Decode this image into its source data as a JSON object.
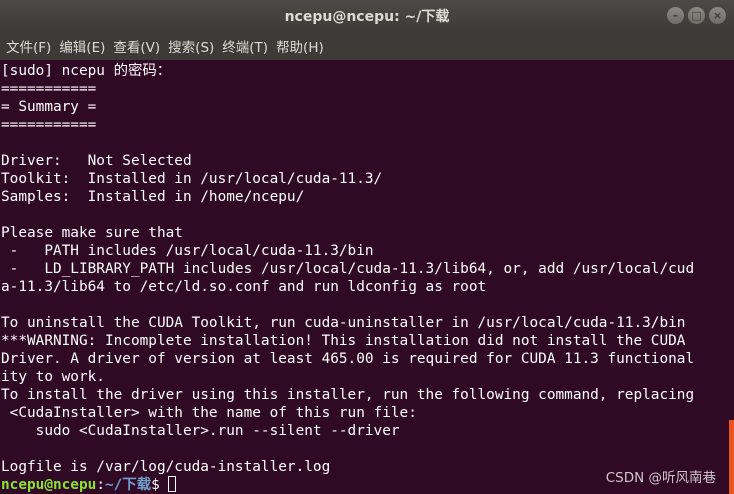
{
  "window": {
    "title": "ncepu@ncepu: ~/下载",
    "controls": {
      "minimize": "–",
      "maximize": "□",
      "close": "×"
    }
  },
  "menu": [
    {
      "label": "文件(F)"
    },
    {
      "label": "编辑(E)"
    },
    {
      "label": "查看(V)"
    },
    {
      "label": "搜索(S)"
    },
    {
      "label": "终端(T)"
    },
    {
      "label": "帮助(H)"
    }
  ],
  "terminal": {
    "lines": [
      "[sudo] ncepu 的密码：",
      "===========",
      "= Summary =",
      "===========",
      "",
      "Driver:   Not Selected",
      "Toolkit:  Installed in /usr/local/cuda-11.3/",
      "Samples:  Installed in /home/ncepu/",
      "",
      "Please make sure that",
      " -   PATH includes /usr/local/cuda-11.3/bin",
      " -   LD_LIBRARY_PATH includes /usr/local/cuda-11.3/lib64, or, add /usr/local/cud",
      "a-11.3/lib64 to /etc/ld.so.conf and run ldconfig as root",
      "",
      "To uninstall the CUDA Toolkit, run cuda-uninstaller in /usr/local/cuda-11.3/bin",
      "***WARNING: Incomplete installation! This installation did not install the CUDA",
      "Driver. A driver of version at least 465.00 is required for CUDA 11.3 functional",
      "ity to work.",
      "To install the driver using this installer, run the following command, replacing",
      " <CudaInstaller> with the name of this run file:",
      "    sudo <CudaInstaller>.run --silent --driver",
      "",
      "Logfile is /var/log/cuda-installer.log"
    ],
    "prompt": {
      "user_host": "ncepu@ncepu",
      "separator": ":",
      "path": "~/下载",
      "symbol": "$ "
    }
  },
  "watermark": "CSDN @听风南巷",
  "colors": {
    "background": "#300a24",
    "titlebar": "#3c3b37",
    "prompt_user": "#8ae234",
    "prompt_path": "#729fcf",
    "scrollbar": "#e95420"
  }
}
